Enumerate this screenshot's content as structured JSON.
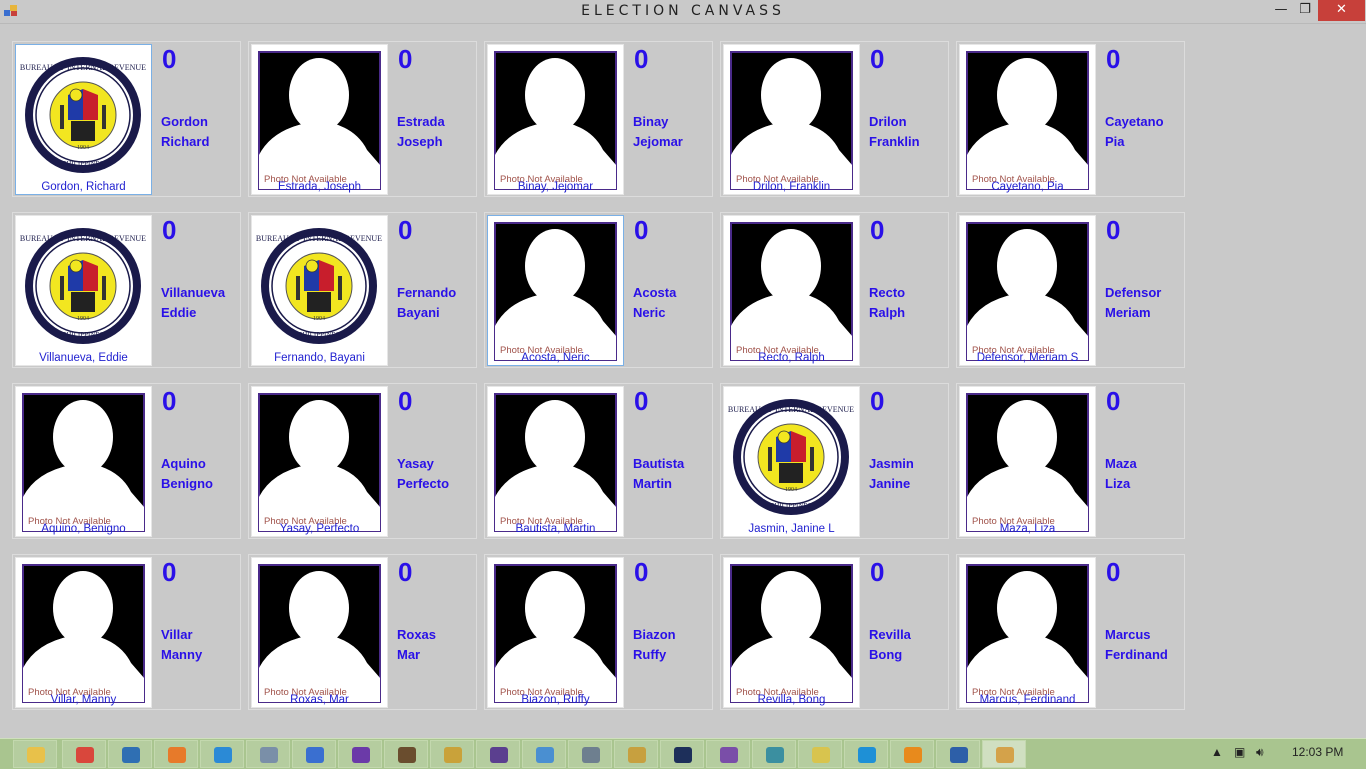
{
  "window": {
    "title": "ELECTION CANVASS"
  },
  "window_controls": {
    "minimize": "—",
    "restore": "❐",
    "close": "✕"
  },
  "caption_placeholder_text": "Photo Not Available",
  "candidates": [
    {
      "votes": "0",
      "first_line": "Gordon",
      "second_line": "Richard",
      "caption": "Gordon, Richard",
      "photo": "seal",
      "selected": true
    },
    {
      "votes": "0",
      "first_line": "Estrada",
      "second_line": "Joseph",
      "caption": "Estrada, Joseph",
      "photo": "placeholder",
      "selected": false
    },
    {
      "votes": "0",
      "first_line": "Binay",
      "second_line": "Jejomar",
      "caption": "Binay, Jejomar",
      "photo": "placeholder",
      "selected": false
    },
    {
      "votes": "0",
      "first_line": "Drilon",
      "second_line": "Franklin",
      "caption": "Drilon, Franklin",
      "photo": "placeholder",
      "selected": false
    },
    {
      "votes": "0",
      "first_line": "Cayetano",
      "second_line": "Pia",
      "caption": "Cayetano, Pia",
      "photo": "placeholder",
      "selected": false
    },
    {
      "votes": "0",
      "first_line": "Villanueva",
      "second_line": "Eddie",
      "caption": "Villanueva, Eddie",
      "photo": "seal",
      "selected": false
    },
    {
      "votes": "0",
      "first_line": "Fernando",
      "second_line": "Bayani",
      "caption": "Fernando, Bayani",
      "photo": "seal",
      "selected": false
    },
    {
      "votes": "0",
      "first_line": "Acosta",
      "second_line": "Neric",
      "caption": "Acosta, Neric",
      "photo": "placeholder",
      "selected": true
    },
    {
      "votes": "0",
      "first_line": "Recto",
      "second_line": "Ralph",
      "caption": "Recto, Ralph",
      "photo": "placeholder",
      "selected": false
    },
    {
      "votes": "0",
      "first_line": "Defensor",
      "second_line": "Meriam",
      "caption": "Defensor, Meriam S",
      "photo": "placeholder",
      "selected": false
    },
    {
      "votes": "0",
      "first_line": "Aquino",
      "second_line": "Benigno",
      "caption": "Aquino, Benigno",
      "photo": "placeholder",
      "selected": false
    },
    {
      "votes": "0",
      "first_line": "Yasay",
      "second_line": "Perfecto",
      "caption": "Yasay, Perfecto",
      "photo": "placeholder",
      "selected": false
    },
    {
      "votes": "0",
      "first_line": "Bautista",
      "second_line": "Martin",
      "caption": "Bautista, Martin",
      "photo": "placeholder",
      "selected": false
    },
    {
      "votes": "0",
      "first_line": "Jasmin",
      "second_line": "Janine",
      "caption": "Jasmin, Janine L",
      "photo": "seal",
      "selected": false
    },
    {
      "votes": "0",
      "first_line": "Maza",
      "second_line": "Liza",
      "caption": "Maza, Liza",
      "photo": "placeholder",
      "selected": false
    },
    {
      "votes": "0",
      "first_line": "Villar",
      "second_line": "Manny",
      "caption": "Villar, Manny",
      "photo": "placeholder",
      "selected": false
    },
    {
      "votes": "0",
      "first_line": "Roxas",
      "second_line": "Mar",
      "caption": "Roxas, Mar",
      "photo": "placeholder",
      "selected": false
    },
    {
      "votes": "0",
      "first_line": "Biazon",
      "second_line": "Ruffy",
      "caption": "Biazon, Ruffy",
      "photo": "placeholder",
      "selected": false
    },
    {
      "votes": "0",
      "first_line": "Revilla",
      "second_line": "Bong",
      "caption": "Revilla, Bong",
      "photo": "placeholder",
      "selected": false
    },
    {
      "votes": "0",
      "first_line": "Marcus",
      "second_line": "Ferdinand",
      "caption": "Marcus, Ferdinand",
      "photo": "placeholder",
      "selected": false
    }
  ],
  "taskbar": {
    "items": [
      {
        "icon": "file-explorer-icon",
        "color": "#e8c14a"
      },
      {
        "icon": "chrome-icon",
        "color": "#d9473c"
      },
      {
        "icon": "remote-desktop-icon",
        "color": "#2f6fb3"
      },
      {
        "icon": "firefox-icon",
        "color": "#e77a2a"
      },
      {
        "icon": "internet-explorer-icon",
        "color": "#2b8ad6"
      },
      {
        "icon": "globe-app-icon",
        "color": "#7a8fa8"
      },
      {
        "icon": "link-app-icon",
        "color": "#3a6fd0"
      },
      {
        "icon": "visual-studio-icon",
        "color": "#6b3aa8"
      },
      {
        "icon": "media-player-icon",
        "color": "#6a4d2e"
      },
      {
        "icon": "paint-icon",
        "color": "#c9a23a"
      },
      {
        "icon": "eclipse-icon",
        "color": "#5b3f8f"
      },
      {
        "icon": "image-viewer-icon",
        "color": "#4a8fd1"
      },
      {
        "icon": "sql-server-icon",
        "color": "#6e7f8f"
      },
      {
        "icon": "tools-icon",
        "color": "#c7a03f"
      },
      {
        "icon": "photoshop-icon",
        "color": "#1d2f5a"
      },
      {
        "icon": "app-swirl-icon",
        "color": "#7a4ea8"
      },
      {
        "icon": "feather-icon",
        "color": "#3b8fa0"
      },
      {
        "icon": "sticky-notes-icon",
        "color": "#d8c44e"
      },
      {
        "icon": "skype-icon",
        "color": "#1e90d6"
      },
      {
        "icon": "video-player-icon",
        "color": "#e88a1c"
      },
      {
        "icon": "pi-app-icon",
        "color": "#2d5fa8"
      },
      {
        "icon": "election-app-icon",
        "color": "#d4a24a"
      }
    ],
    "clock": "12:03 PM"
  }
}
